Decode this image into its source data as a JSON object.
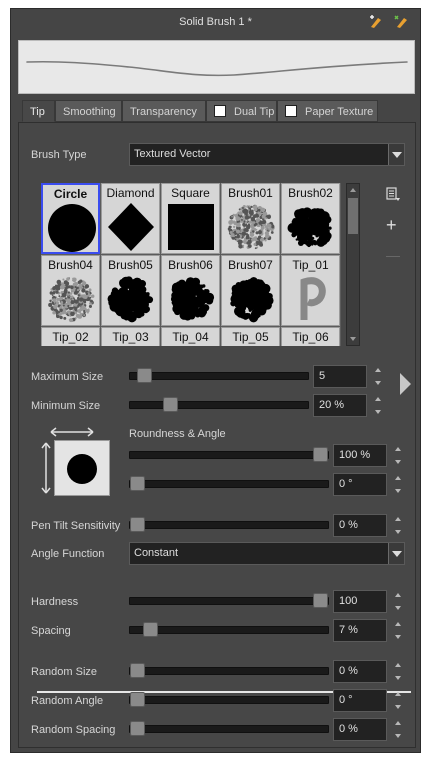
{
  "window": {
    "title": "Solid Brush 1 *"
  },
  "tabs": [
    {
      "label": "Tip",
      "active": true
    },
    {
      "label": "Smoothing"
    },
    {
      "label": "Transparency"
    },
    {
      "label": "Dual Tip",
      "checkbox": true
    },
    {
      "label": "Paper Texture",
      "checkbox": true
    }
  ],
  "brush_type": {
    "label": "Brush Type",
    "value": "Textured Vector"
  },
  "brush_tips": [
    {
      "name": "Circle",
      "selected": true,
      "shape": "circle"
    },
    {
      "name": "Diamond",
      "shape": "diamond"
    },
    {
      "name": "Square",
      "shape": "square"
    },
    {
      "name": "Brush01",
      "shape": "texture-light"
    },
    {
      "name": "Brush02",
      "shape": "texture-dark"
    },
    {
      "name": "Brush04",
      "shape": "texture-light"
    },
    {
      "name": "Brush05",
      "shape": "texture-dark"
    },
    {
      "name": "Brush06",
      "shape": "texture-dark"
    },
    {
      "name": "Brush07",
      "shape": "texture-dark"
    },
    {
      "name": "Tip_01",
      "shape": "texture-p"
    },
    {
      "name": "Tip_02",
      "shape": "partial"
    },
    {
      "name": "Tip_03",
      "shape": "partial"
    },
    {
      "name": "Tip_04",
      "shape": "partial"
    },
    {
      "name": "Tip_05",
      "shape": "partial"
    },
    {
      "name": "Tip_06",
      "shape": "partial"
    }
  ],
  "side_buttons": {
    "menu_icon": "menu-icon",
    "add_label": "+",
    "remove_label": "—"
  },
  "sizes": {
    "max": {
      "label": "Maximum Size",
      "value": "5",
      "level": 0.04
    },
    "min": {
      "label": "Minimum Size",
      "value": "20 %",
      "level": 0.2
    }
  },
  "roundness_angle": {
    "label": "Roundness & Angle",
    "roundness": {
      "value": "100 %",
      "level": 1.0
    },
    "angle": {
      "value": "0 °",
      "level": 0.0
    }
  },
  "pen_tilt": {
    "label": "Pen Tilt Sensitivity",
    "value": "0 %",
    "level": 0.0
  },
  "angle_function": {
    "label": "Angle Function",
    "value": "Constant"
  },
  "hardness": {
    "label": "Hardness",
    "value": "100",
    "level": 1.0
  },
  "spacing": {
    "label": "Spacing",
    "value": "7 %",
    "level": 0.07
  },
  "random_size": {
    "label": "Random Size",
    "value": "0 %",
    "level": 0.0
  },
  "random_angle": {
    "label": "Random Angle",
    "value": "0 °",
    "level": 0.0
  },
  "random_spacing": {
    "label": "Random Spacing",
    "value": "0 %",
    "level": 0.0
  },
  "colors": {
    "selected_border": "#3a4cf0",
    "panel_bg": "#474747",
    "field_bg": "#222222"
  }
}
